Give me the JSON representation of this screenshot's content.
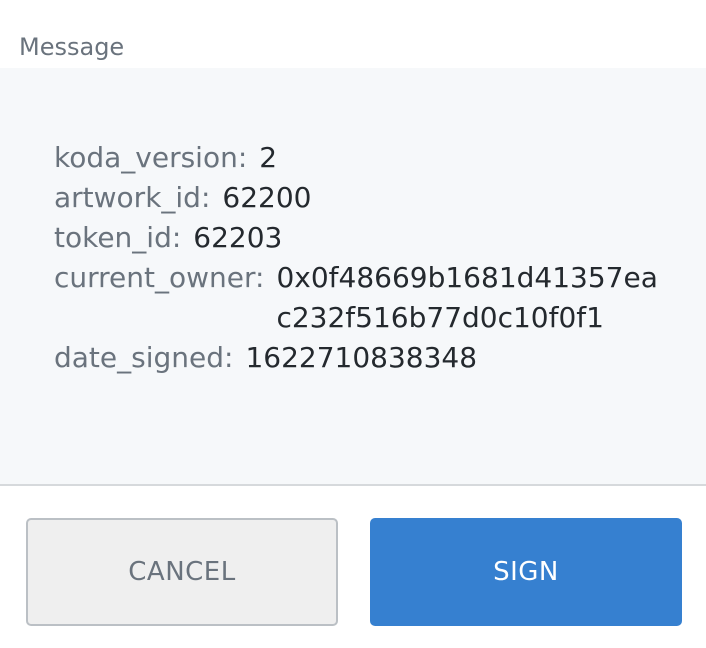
{
  "section_title": "Message",
  "message": {
    "fields": [
      {
        "key": "koda_version:",
        "value": "2"
      },
      {
        "key": "artwork_id:",
        "value": "62200"
      },
      {
        "key": "token_id:",
        "value": "62203"
      },
      {
        "key": "current_owner:",
        "value": "0x0f48669b1681d41357eac232f516b77d0c10f0f1"
      },
      {
        "key": "date_signed:",
        "value": "1622710838348"
      }
    ]
  },
  "buttons": {
    "cancel_label": "CANCEL",
    "sign_label": "SIGN"
  },
  "colors": {
    "sign_button": "#3680d0",
    "cancel_button": "#efefef",
    "panel_background": "#f6f8fa"
  }
}
